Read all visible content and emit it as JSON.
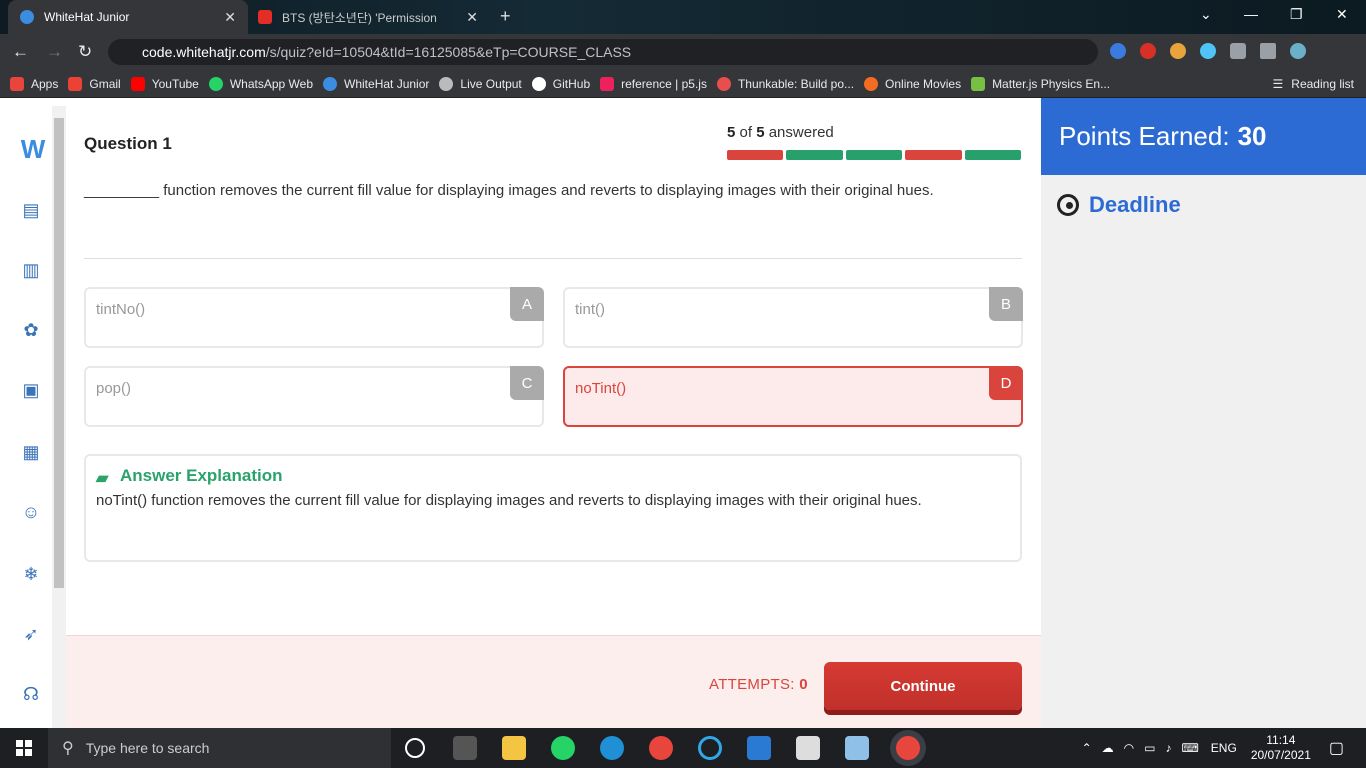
{
  "browser": {
    "tabs": [
      {
        "title": "WhiteHat Junior",
        "active": true
      },
      {
        "title": "BTS (방탄소년단) 'Permission",
        "active": false
      }
    ],
    "url_host": "code.whitehatjr.com",
    "url_path": "/s/quiz?eId=10504&tId=16125085&eTp=COURSE_CLASS",
    "bookmarks": [
      "Apps",
      "Gmail",
      "YouTube",
      "WhatsApp Web",
      "WhiteHat Junior",
      "Live Output",
      "GitHub",
      "reference | p5.js",
      "Thunkable: Build po...",
      "Online Movies",
      "Matter.js Physics En..."
    ],
    "reading_list": "Reading list"
  },
  "quiz": {
    "title": "Question 1",
    "answered_done": "5",
    "answered_of": "of",
    "answered_total": "5",
    "answered_label": "answered",
    "progress": [
      "wrong",
      "correct",
      "correct",
      "wrong",
      "correct"
    ],
    "question": "_________ function removes the current fill value for displaying images and reverts to displaying images with their original hues.",
    "options": [
      {
        "letter": "A",
        "text": "tintNo()"
      },
      {
        "letter": "B",
        "text": "tint()"
      },
      {
        "letter": "C",
        "text": "pop()"
      },
      {
        "letter": "D",
        "text": "noTint()",
        "state": "wrong"
      }
    ],
    "explanation_title": "Answer Explanation",
    "explanation": "noTint() function removes the current fill value for displaying images and reverts to displaying images with their original hues.",
    "attempts_label": "ATTEMPTS:",
    "attempts_value": "0",
    "continue_label": "Continue"
  },
  "sidebar": {
    "points_label": "Points Earned:",
    "points_value": "30",
    "deadline_label": "Deadline"
  },
  "taskbar": {
    "search_placeholder": "Type here to search",
    "lang": "ENG",
    "time": "11:14",
    "date": "20/07/2021"
  },
  "colors": {
    "accent": "#2d6bd4",
    "correct": "#27a06b",
    "wrong": "#d9453d"
  }
}
